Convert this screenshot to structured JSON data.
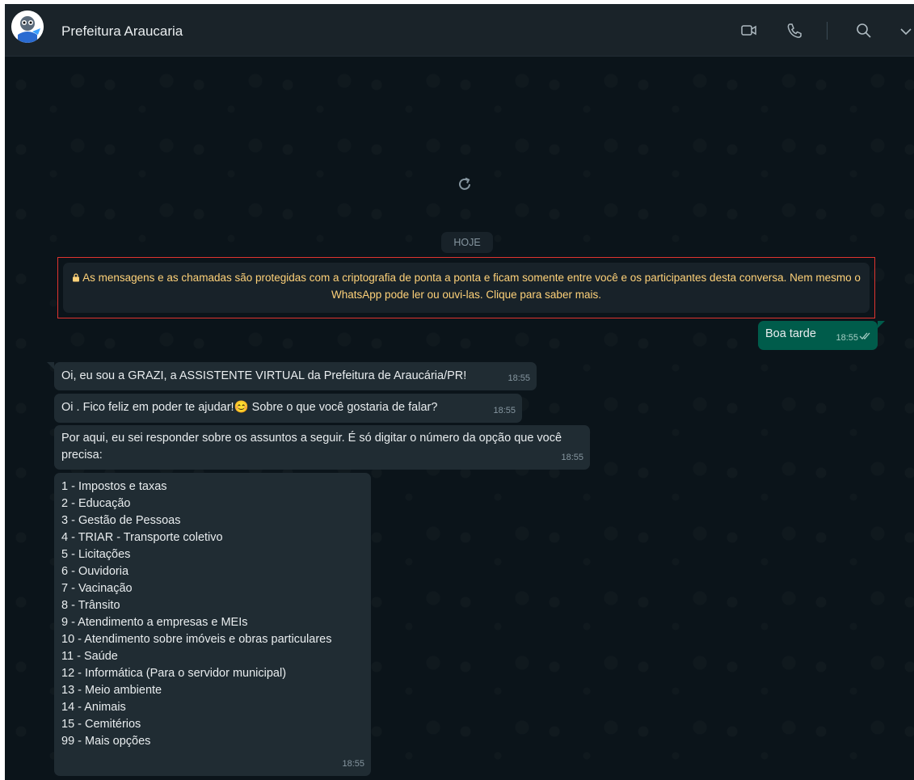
{
  "header": {
    "contact_name": "Prefeitura Araucaria",
    "icons": [
      "video-call-icon",
      "voice-call-icon",
      "search-icon",
      "chevron-down-icon"
    ]
  },
  "chat": {
    "date_label": "HOJE",
    "encryption_notice": "As mensagens e as chamadas são protegidas com a criptografia de ponta a ponta e ficam somente entre você e os participantes desta conversa. Nem mesmo o WhatsApp pode ler ou ouvi-las. Clique para saber mais.",
    "outgoing": {
      "text": "Boa tarde",
      "time": "18:55",
      "status": "read"
    },
    "incoming": [
      {
        "text": "Oi, eu sou a GRAZI, a ASSISTENTE VIRTUAL da Prefeitura de Araucária/PR!",
        "time": "18:55"
      },
      {
        "text_before": "Oi . Fico feliz em poder te ajudar!",
        "emoji": "😊",
        "text_after": " Sobre o que você gostaria de falar?",
        "time": "18:55"
      },
      {
        "text": "Por aqui, eu sei responder sobre os assuntos a seguir. É só digitar o número da opção que você precisa:",
        "time": "18:55"
      }
    ],
    "menu": {
      "options": [
        "1 - Impostos e taxas",
        "2 - Educação",
        "3 - Gestão de Pessoas",
        "4 - TRIAR - Transporte coletivo",
        "5 - Licitações",
        "6 - Ouvidoria",
        "7 - Vacinação",
        "8 - Trânsito",
        "9 - Atendimento a empresas e MEIs",
        "10 - Atendimento sobre imóveis e obras particulares",
        "11 - Saúde",
        "12 - Informática (Para o servidor municipal)",
        "13 - Meio ambiente",
        "14 - Animais",
        "15 - Cemitérios",
        "99 - Mais opções"
      ],
      "time": "18:55"
    }
  },
  "colors": {
    "background": "#0b141a",
    "header": "#1a2329",
    "incoming_bubble": "#202c33",
    "outgoing_bubble": "#005c4b",
    "notice_text": "#ffd279",
    "highlight_border": "#e0342f"
  }
}
